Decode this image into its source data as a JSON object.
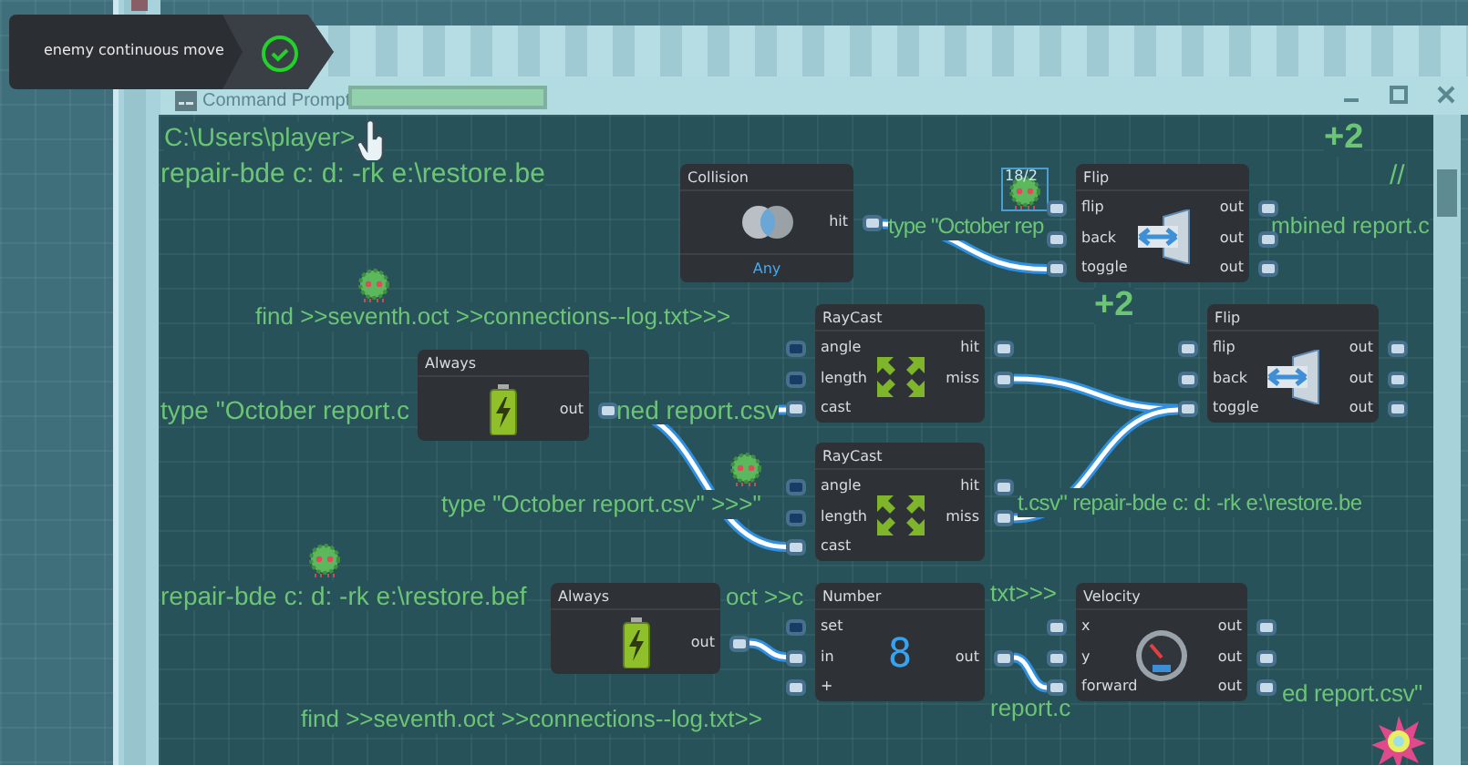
{
  "banner": {
    "text": "enemy continuous move",
    "done": true
  },
  "window": {
    "title": "Command Prompt"
  },
  "terminal": [
    {
      "kind": "prompt",
      "text": "C:\\Users\\player>"
    },
    {
      "kind": "line",
      "text": "repair-bde c: d: -rk e:\\restore.be"
    },
    {
      "kind": "score",
      "text": "+2"
    },
    {
      "kind": "line",
      "text": "//"
    },
    {
      "kind": "line",
      "text": "type \"October rep"
    },
    {
      "kind": "line",
      "text": "mbined report.c"
    },
    {
      "kind": "score",
      "text": "+2"
    },
    {
      "kind": "line",
      "text": "find >>seventh.oct >>connections--log.txt>>>"
    },
    {
      "kind": "line",
      "text": "type \"October report.c"
    },
    {
      "kind": "line",
      "text": "ned report.csv"
    },
    {
      "kind": "line",
      "text": "type \"October report.csv\" >>>\""
    },
    {
      "kind": "line",
      "text": "t.csv\" repair-bde c: d: -rk e:\\restore.be"
    },
    {
      "kind": "line",
      "text": "repair-bde c: d: -rk e:\\restore.bef"
    },
    {
      "kind": "line",
      "text": "oct >>c"
    },
    {
      "kind": "line",
      "text": "txt>>>"
    },
    {
      "kind": "line",
      "text": "find >>seventh.oct >>connections--log.txt>>"
    },
    {
      "kind": "line",
      "text": "report.c"
    },
    {
      "kind": "line",
      "text": "ed report.csv\""
    }
  ],
  "enemy_badge": "18/2",
  "nodes": [
    {
      "kind": "collision",
      "title": "Collision",
      "outputs": [
        {
          "label": "hit"
        }
      ],
      "footer": "Any"
    },
    {
      "kind": "flip",
      "title": "Flip",
      "inputs": [
        {
          "label": "flip",
          "lit": true
        },
        {
          "label": "back",
          "lit": true
        },
        {
          "label": "toggle",
          "lit": true
        }
      ],
      "outputs": [
        {
          "label": "out"
        },
        {
          "label": "out"
        },
        {
          "label": "out"
        }
      ]
    },
    {
      "kind": "always",
      "title": "Always",
      "outputs": [
        {
          "label": "out"
        }
      ]
    },
    {
      "kind": "raycast",
      "title": "RayCast",
      "inputs": [
        {
          "label": "angle",
          "lit": false
        },
        {
          "label": "length",
          "lit": false
        },
        {
          "label": "cast",
          "lit": true
        }
      ],
      "outputs": [
        {
          "label": "hit"
        },
        {
          "label": "miss"
        }
      ]
    },
    {
      "kind": "flip",
      "title": "Flip",
      "inputs": [
        {
          "label": "flip",
          "lit": true
        },
        {
          "label": "back",
          "lit": true
        },
        {
          "label": "toggle",
          "lit": true
        }
      ],
      "outputs": [
        {
          "label": "out"
        },
        {
          "label": "out"
        },
        {
          "label": "out"
        }
      ]
    },
    {
      "kind": "raycast",
      "title": "RayCast",
      "inputs": [
        {
          "label": "angle",
          "lit": false
        },
        {
          "label": "length",
          "lit": false
        },
        {
          "label": "cast",
          "lit": true
        }
      ],
      "outputs": [
        {
          "label": "hit"
        },
        {
          "label": "miss"
        }
      ]
    },
    {
      "kind": "always",
      "title": "Always",
      "outputs": [
        {
          "label": "out"
        }
      ]
    },
    {
      "kind": "number",
      "title": "Number",
      "inputs": [
        {
          "label": "set",
          "lit": false
        },
        {
          "label": "in",
          "lit": true
        },
        {
          "label": "+",
          "lit": true
        }
      ],
      "outputs": [
        {
          "label": "out"
        }
      ],
      "value": "8"
    },
    {
      "kind": "velocity",
      "title": "Velocity",
      "inputs": [
        {
          "label": "x",
          "lit": true
        },
        {
          "label": "y",
          "lit": true
        },
        {
          "label": "forward",
          "lit": true
        }
      ],
      "outputs": [
        {
          "label": "out"
        },
        {
          "label": "out"
        },
        {
          "label": "out"
        }
      ]
    }
  ]
}
